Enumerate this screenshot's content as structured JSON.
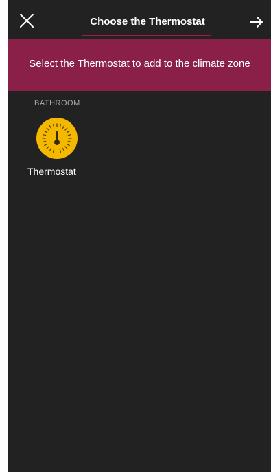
{
  "header": {
    "title": "Choose the Thermostat",
    "close_icon": "close-icon",
    "next_icon": "arrow-right-icon"
  },
  "banner": {
    "text": "Select the Thermostat to add to the climate zone"
  },
  "section": {
    "label": "BATHROOM"
  },
  "devices": [
    {
      "label": "Thermostat",
      "icon": "thermostat-icon"
    }
  ],
  "colors": {
    "background": "#222222",
    "banner": "#8a1f47",
    "accent": "#a01c43",
    "icon_yellow": "#f5b800",
    "section_text": "#a9a9a9"
  }
}
